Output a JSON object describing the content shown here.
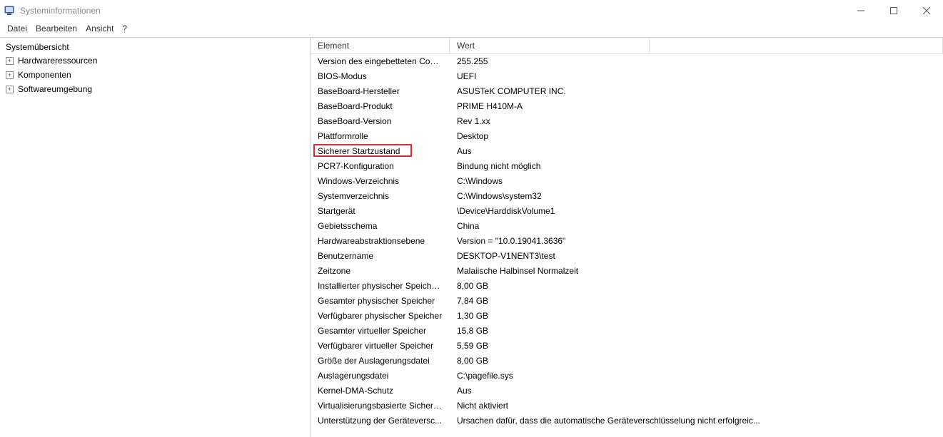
{
  "window": {
    "title": "Systeminformationen"
  },
  "menu": {
    "file": "Datei",
    "edit": "Bearbeiten",
    "view": "Ansicht",
    "help": "?"
  },
  "tree": {
    "root": "Systemübersicht",
    "nodes": [
      {
        "label": "Hardwareressourcen"
      },
      {
        "label": "Komponenten"
      },
      {
        "label": "Softwareumgebung"
      }
    ]
  },
  "columns": {
    "key": "Element",
    "value": "Wert"
  },
  "rows": [
    {
      "k": "Version des eingebetteten Cont...",
      "v": "255.255"
    },
    {
      "k": "BIOS-Modus",
      "v": "UEFI"
    },
    {
      "k": "BaseBoard-Hersteller",
      "v": "ASUSTeK COMPUTER INC."
    },
    {
      "k": "BaseBoard-Produkt",
      "v": "PRIME H410M-A"
    },
    {
      "k": "BaseBoard-Version",
      "v": "Rev 1.xx"
    },
    {
      "k": "Plattformrolle",
      "v": "Desktop"
    },
    {
      "k": "Sicherer Startzustand",
      "v": "Aus",
      "highlight": true
    },
    {
      "k": "PCR7-Konfiguration",
      "v": "Bindung nicht möglich"
    },
    {
      "k": "Windows-Verzeichnis",
      "v": "C:\\Windows"
    },
    {
      "k": "Systemverzeichnis",
      "v": "C:\\Windows\\system32"
    },
    {
      "k": "Startgerät",
      "v": "\\Device\\HarddiskVolume1"
    },
    {
      "k": "Gebietsschema",
      "v": "China"
    },
    {
      "k": "Hardwareabstraktionsebene",
      "v": "Version = \"10.0.19041.3636\""
    },
    {
      "k": "Benutzername",
      "v": "DESKTOP-V1NENT3\\test"
    },
    {
      "k": "Zeitzone",
      "v": "Malaiische Halbinsel Normalzeit"
    },
    {
      "k": "Installierter physischer Speicher...",
      "v": "8,00 GB"
    },
    {
      "k": "Gesamter physischer Speicher",
      "v": "7,84 GB"
    },
    {
      "k": "Verfügbarer physischer Speicher",
      "v": "1,30 GB"
    },
    {
      "k": "Gesamter virtueller Speicher",
      "v": "15,8 GB"
    },
    {
      "k": "Verfügbarer virtueller Speicher",
      "v": "5,59 GB"
    },
    {
      "k": "Größe der Auslagerungsdatei",
      "v": "8,00 GB"
    },
    {
      "k": "Auslagerungsdatei",
      "v": "C:\\pagefile.sys"
    },
    {
      "k": "Kernel-DMA-Schutz",
      "v": "Aus"
    },
    {
      "k": "Virtualisierungsbasierte Sicherh...",
      "v": "Nicht aktiviert"
    },
    {
      "k": "Unterstützung der Geräteversc...",
      "v": "Ursachen dafür, dass die automatische Geräteverschlüsselung nicht erfolgreic..."
    }
  ]
}
